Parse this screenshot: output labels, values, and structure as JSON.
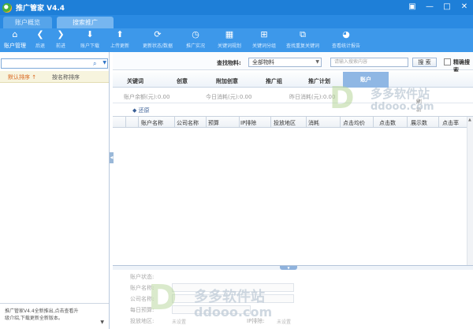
{
  "app": {
    "title": "推广管家 V4.4",
    "window_controls": {
      "skin": "▣",
      "minimize": "—",
      "maximize": "□",
      "close": "✕"
    }
  },
  "top_tabs": [
    {
      "label": "账户概览"
    },
    {
      "label": "搜索推广"
    }
  ],
  "toolbar": {
    "items": [
      {
        "label": "账户管理",
        "icon": "home-icon",
        "glyph": "⌂"
      },
      {
        "label": "后退",
        "icon": "back-icon",
        "glyph": "❮"
      },
      {
        "label": "前进",
        "icon": "forward-icon",
        "glyph": "❯"
      },
      {
        "label": "账户下载",
        "icon": "download-icon",
        "glyph": "⬇"
      },
      {
        "label": "上传更新",
        "icon": "upload-icon",
        "glyph": "⬆"
      },
      {
        "label": "更新状态/数据",
        "icon": "refresh-icon",
        "glyph": "⟳"
      },
      {
        "label": "推广实况",
        "icon": "clock-icon",
        "glyph": "◷"
      },
      {
        "label": "关键词规划",
        "icon": "plan-icon",
        "glyph": "▦"
      },
      {
        "label": "关键词分组",
        "icon": "group-icon",
        "glyph": "⊞"
      },
      {
        "label": "查找重复关键词",
        "icon": "duplicate-icon",
        "glyph": "⧉"
      },
      {
        "label": "查看统计报告",
        "icon": "report-icon",
        "glyph": "◕"
      }
    ]
  },
  "sidebar": {
    "search_placeholder": "",
    "sort_default": "默认排序 ↑",
    "sort_by_name": "按名称排序",
    "footer_line1": "推广管家V4.4全新推出,点击查看升",
    "footer_line2": "级介绍,下载更新全新版本。",
    "footer_arrow": "▼"
  },
  "search": {
    "label": "查找物料:",
    "scope_value": "全部物料",
    "input_placeholder": "请输入搜索内容",
    "button_label": "搜 索",
    "precise_label": "精确搜索"
  },
  "sub_tabs": [
    {
      "label": "关键词"
    },
    {
      "label": "创意"
    },
    {
      "label": "附加创意"
    },
    {
      "label": "推广组"
    },
    {
      "label": "推广计划"
    },
    {
      "label": "账户",
      "active": true
    }
  ],
  "stats": {
    "balance": "账户余额(元):0.00",
    "today_spend": "今日消耗(元):0.00",
    "yesterday_spend": "昨日消耗(元):0.00",
    "refresh": "刷新"
  },
  "restore_label": "还原",
  "table": {
    "columns": [
      "账户名称",
      "公司名称",
      "预算",
      "IP排除",
      "投放地区",
      "消耗",
      "点击均价",
      "点击数",
      "展示数",
      "点击率"
    ]
  },
  "detail": {
    "fields": [
      {
        "label": "账户状态:",
        "value": ""
      },
      {
        "label": "账户名称:",
        "value": ""
      },
      {
        "label": "公司名称:",
        "value": ""
      },
      {
        "label": "每日预算:",
        "value": ""
      },
      {
        "label": "投放地区:",
        "value": "未设置"
      }
    ],
    "ip_label": "IP排除:",
    "ip_value": "未设置"
  },
  "watermark": {
    "brand": "多多软件站",
    "url": "ddooo.com"
  },
  "colors": {
    "titlebar": "#1e7fd8",
    "toolbar": "#3d98ea",
    "active_tab": "#8fb7e4",
    "sort_highlight": "#d9651d"
  }
}
